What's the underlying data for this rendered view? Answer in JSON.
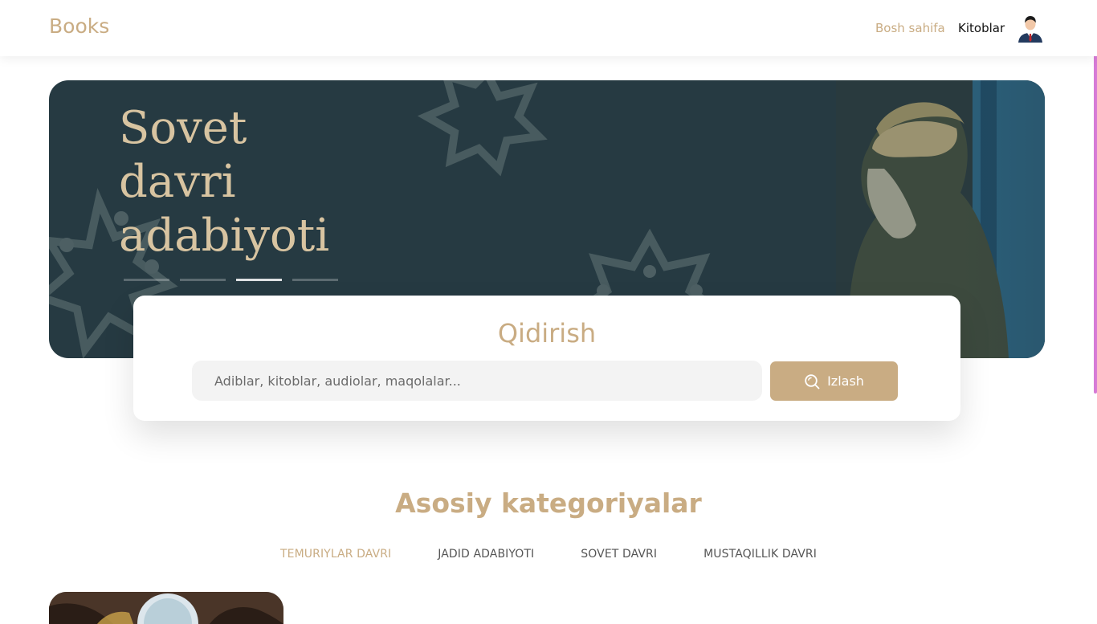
{
  "nav": {
    "brand": "Books",
    "links": [
      {
        "label": "Bosh sahifa"
      },
      {
        "label": "Kitoblar"
      }
    ]
  },
  "hero": {
    "title_lines": [
      "Sovet",
      "davri",
      "adabiyoti"
    ],
    "slides_count": 4,
    "active_slide": 3
  },
  "search": {
    "title": "Qidirish",
    "placeholder": "Adiblar, kitoblar, audiolar, maqolalar...",
    "value": "",
    "button_label": "Izlash"
  },
  "categories": {
    "title": "Asosiy kategoriyalar",
    "tabs": [
      {
        "label": "TEMURIYLAR DAVRI",
        "active": true
      },
      {
        "label": "JADID ADABIYOTI",
        "active": false
      },
      {
        "label": "SOVET DAVRI",
        "active": false
      },
      {
        "label": "MUSTAQILLIK DAVRI",
        "active": false
      }
    ]
  },
  "colors": {
    "accent": "#c9ac83",
    "hero_bg": "#263a42",
    "hero_text": "#d8c4a1"
  },
  "icons": {
    "search_button_icon": "search-icon",
    "avatar": "user-avatar"
  }
}
